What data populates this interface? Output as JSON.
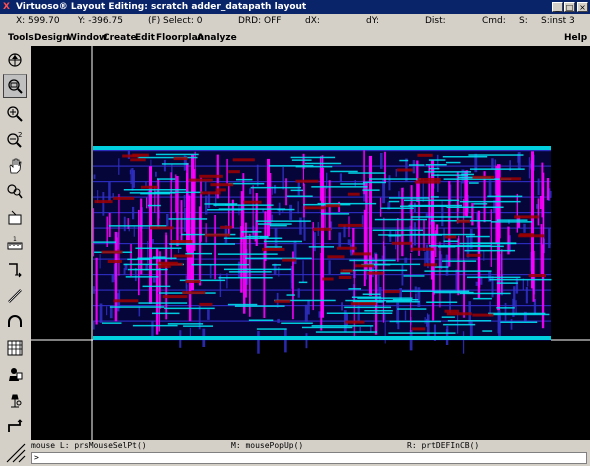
{
  "window": {
    "title": "Virtuoso® Layout Editing: scratch adder_datapath layout",
    "icon_glyph": "X",
    "minimize_glyph": "_",
    "maximize_glyph": "□",
    "close_glyph": "×"
  },
  "status": {
    "x": "X:  599.70",
    "y": "Y:  -396.75",
    "select": "(F) Select: 0",
    "drd": "DRD: OFF",
    "dx": "dX:",
    "dy": "dY:",
    "dist": "Dist:",
    "cmd": "Cmd:",
    "s": "S:",
    "sinst": "S:inst  3"
  },
  "menu": [
    "Tools",
    "Design",
    "Window",
    "Create",
    "Edit",
    "Floorplan",
    "Analyze"
  ],
  "menu_help": "Help",
  "toolbar_icons": [
    "fit-view-icon",
    "zoom-box-icon",
    "zoom-in-icon",
    "zoom-out-2-icon",
    "pan-hand-icon",
    "search-icon",
    "rectangle-icon",
    "ruler-icon",
    "stretch-icon",
    "path-icon",
    "arc-icon",
    "array-grid-icon",
    "copy-icon",
    "probe-icon",
    "wire-icon",
    "resize-grip-icon"
  ],
  "mouse_hints": {
    "left": "mouse L: prsMouseSelPt()",
    "middle": "M: mousePopUp()",
    "right": "R: prtDEFInCB()"
  },
  "prompt": ">",
  "colors": {
    "title_bg": "#0a246a",
    "canvas_bg": "#000000",
    "metal1": "#3030c8",
    "metal2": "#ff00ff",
    "metal3": "#00e0f0",
    "label": "#a00000"
  }
}
